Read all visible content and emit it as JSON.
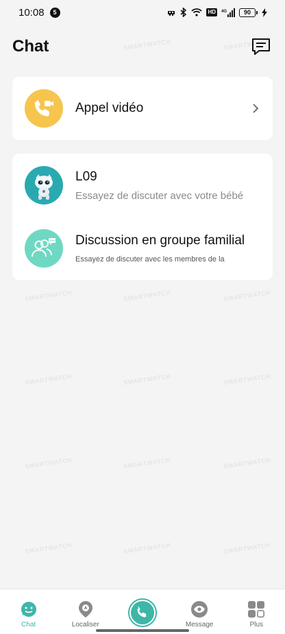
{
  "status_bar": {
    "time": "10:08",
    "notification_count": "5",
    "hd": "HD",
    "signal_label": "4G",
    "battery": "90"
  },
  "header": {
    "title": "Chat"
  },
  "video_call": {
    "label": "Appel vidéo"
  },
  "chats": [
    {
      "title": "L09",
      "subtitle": "Essayez de discuter avec votre bébé"
    },
    {
      "title": "Discussion en groupe familial",
      "subtitle": "Essayez de discuter avec les membres de la"
    }
  ],
  "watermark_text": "SMARTWATCH",
  "bottom_nav": {
    "items": [
      {
        "label": "Chat",
        "icon": "chat-face-icon",
        "active": true
      },
      {
        "label": "Localiser",
        "icon": "location-pin-icon",
        "active": false
      },
      {
        "label": "",
        "icon": "phone-icon",
        "active": false
      },
      {
        "label": "Message",
        "icon": "eye-icon",
        "active": false
      },
      {
        "label": "Plus",
        "icon": "grid-icon",
        "active": false
      }
    ]
  },
  "colors": {
    "accent": "#3fb6a8",
    "video_avatar": "#f6c54e",
    "device_avatar": "#2aa9b0",
    "group_avatar": "#6fd8c2",
    "background": "#f4f4f4"
  }
}
